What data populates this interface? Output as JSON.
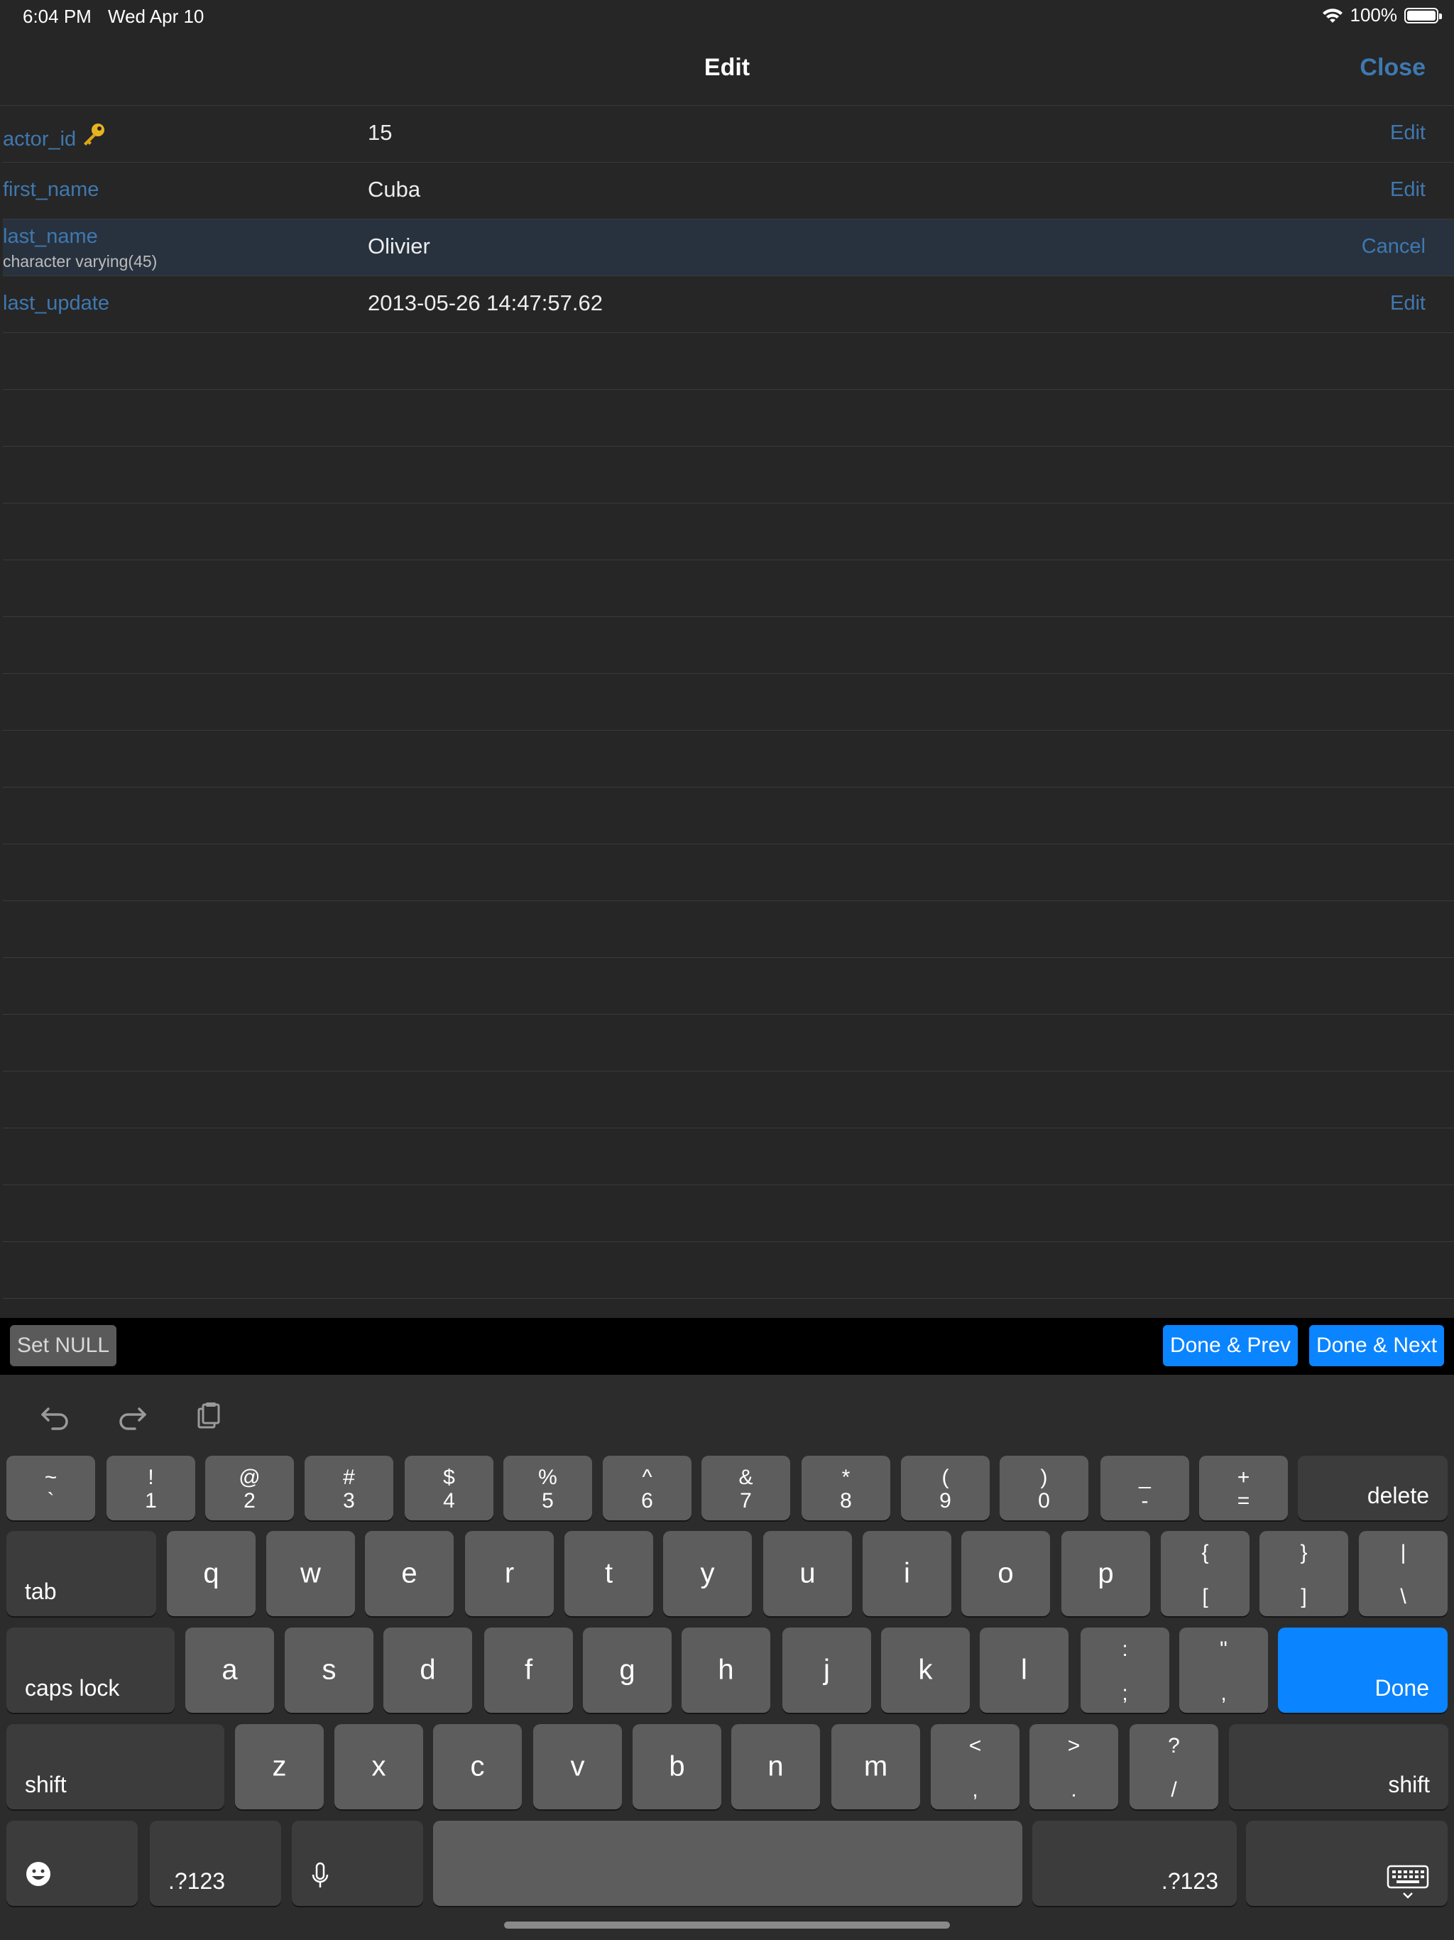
{
  "status": {
    "time": "6:04 PM",
    "date": "Wed Apr 10",
    "battery": "100%"
  },
  "nav": {
    "title": "Edit",
    "close": "Close"
  },
  "rows": [
    {
      "name": "actor_id",
      "value": "15",
      "action": "Edit",
      "primary_key": true
    },
    {
      "name": "first_name",
      "value": "Cuba",
      "action": "Edit"
    },
    {
      "name": "last_name",
      "type": "character varying(45)",
      "value": "Olivier",
      "action": "Cancel",
      "active": true
    },
    {
      "name": "last_update",
      "value": "2013-05-26 14:47:57.62",
      "action": "Edit"
    }
  ],
  "accessory": {
    "set_null": "Set NULL",
    "done_prev": "Done & Prev",
    "done_next": "Done & Next"
  },
  "keyboard": {
    "row1": [
      {
        "t": "~",
        "b": "`"
      },
      {
        "t": "!",
        "b": "1"
      },
      {
        "t": "@",
        "b": "2"
      },
      {
        "t": "#",
        "b": "3"
      },
      {
        "t": "$",
        "b": "4"
      },
      {
        "t": "%",
        "b": "5"
      },
      {
        "t": "^",
        "b": "6"
      },
      {
        "t": "&",
        "b": "7"
      },
      {
        "t": "*",
        "b": "8"
      },
      {
        "t": "(",
        "b": "9"
      },
      {
        "t": ")",
        "b": "0"
      },
      {
        "t": "_",
        "b": "-"
      },
      {
        "t": "+",
        "b": "="
      }
    ],
    "delete": "delete",
    "tab": "tab",
    "row2": [
      "q",
      "w",
      "e",
      "r",
      "t",
      "y",
      "u",
      "i",
      "o",
      "p"
    ],
    "row2_sym": [
      {
        "t": "{",
        "b": "["
      },
      {
        "t": "}",
        "b": "]"
      },
      {
        "t": "|",
        "b": "\\"
      }
    ],
    "caps": "caps lock",
    "row3": [
      "a",
      "s",
      "d",
      "f",
      "g",
      "h",
      "j",
      "k",
      "l"
    ],
    "row3_sym": [
      {
        "t": ":",
        "b": ";"
      },
      {
        "t": "\"",
        "b": ","
      }
    ],
    "done": "Done",
    "shift": "shift",
    "row4": [
      "z",
      "x",
      "c",
      "v",
      "b",
      "n",
      "m"
    ],
    "row4_sym": [
      {
        "t": "<",
        "b": ","
      },
      {
        "t": ">",
        "b": "."
      },
      {
        "t": "?",
        "b": "/"
      }
    ],
    "numbers": ".?123"
  }
}
